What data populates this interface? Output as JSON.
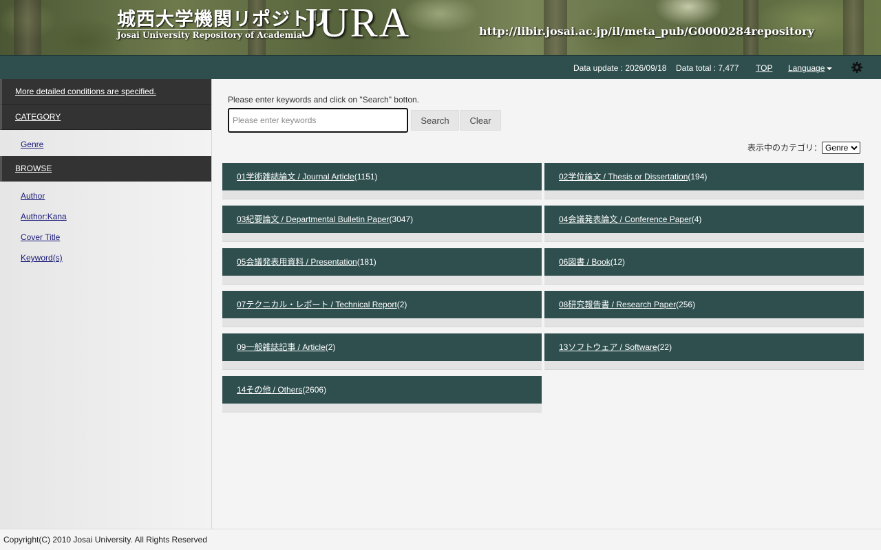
{
  "banner": {
    "logo_jp": "城西大学機関リポジトリ",
    "logo_en": "Josai University Repository of Academia",
    "logo_big": "JURA",
    "url": "http://libir.josai.ac.jp/il/meta_pub/G0000284repository"
  },
  "topbar": {
    "data_update": "Data update : 2026/09/18",
    "data_total": "Data total : 7,477",
    "top_link": "TOP",
    "language_link": "Language",
    "settings_icon": "gear-icon"
  },
  "sidebar": {
    "detailed_link": "More detailed conditions are specified.",
    "category_label": "CATEGORY",
    "category_items": [
      {
        "label": "Genre"
      }
    ],
    "browse_label": "BROWSE",
    "browse_items": [
      {
        "label": "Author"
      },
      {
        "label": "Author:Kana"
      },
      {
        "label": "Cover Title"
      },
      {
        "label": "Keyword(s)"
      }
    ]
  },
  "search": {
    "prompt": "Please enter keywords and click on \"Search\" botton.",
    "placeholder": "Please enter keywords",
    "search_button": "Search",
    "clear_button": "Clear",
    "category_display_label": "表示中のカテゴリ：",
    "category_selected": "Genre"
  },
  "categories": [
    {
      "link": "01学術雑誌論文 / Journal Article",
      "count": "(1151)"
    },
    {
      "link": "02学位論文 / Thesis or Dissertation",
      "count": "(194)"
    },
    {
      "link": "03紀要論文 / Departmental Bulletin Paper",
      "count": "(3047)"
    },
    {
      "link": "04会議発表論文 / Conference Paper",
      "count": "(4)"
    },
    {
      "link": "05会議発表用資料 / Presentation",
      "count": "(181)"
    },
    {
      "link": "06図書 / Book",
      "count": "(12)"
    },
    {
      "link": "07テクニカル・レポート / Technical Report",
      "count": "(2)"
    },
    {
      "link": "08研究報告書 / Research Paper",
      "count": "(256)"
    },
    {
      "link": "09一般雑誌記事 / Article",
      "count": "(2)"
    },
    {
      "link": "13ソフトウェア / Software",
      "count": "(22)"
    },
    {
      "link": "14その他 / Others",
      "count": "(2606)"
    }
  ],
  "footer": {
    "copyright": "Copyright(C) 2010 Josai University. All Rights Reserved"
  },
  "colors": {
    "header_bar": "#2f4f4f",
    "sidebar_head": "#333333",
    "card_bar": "#2f4f4f",
    "link": "#1a1a7a"
  }
}
